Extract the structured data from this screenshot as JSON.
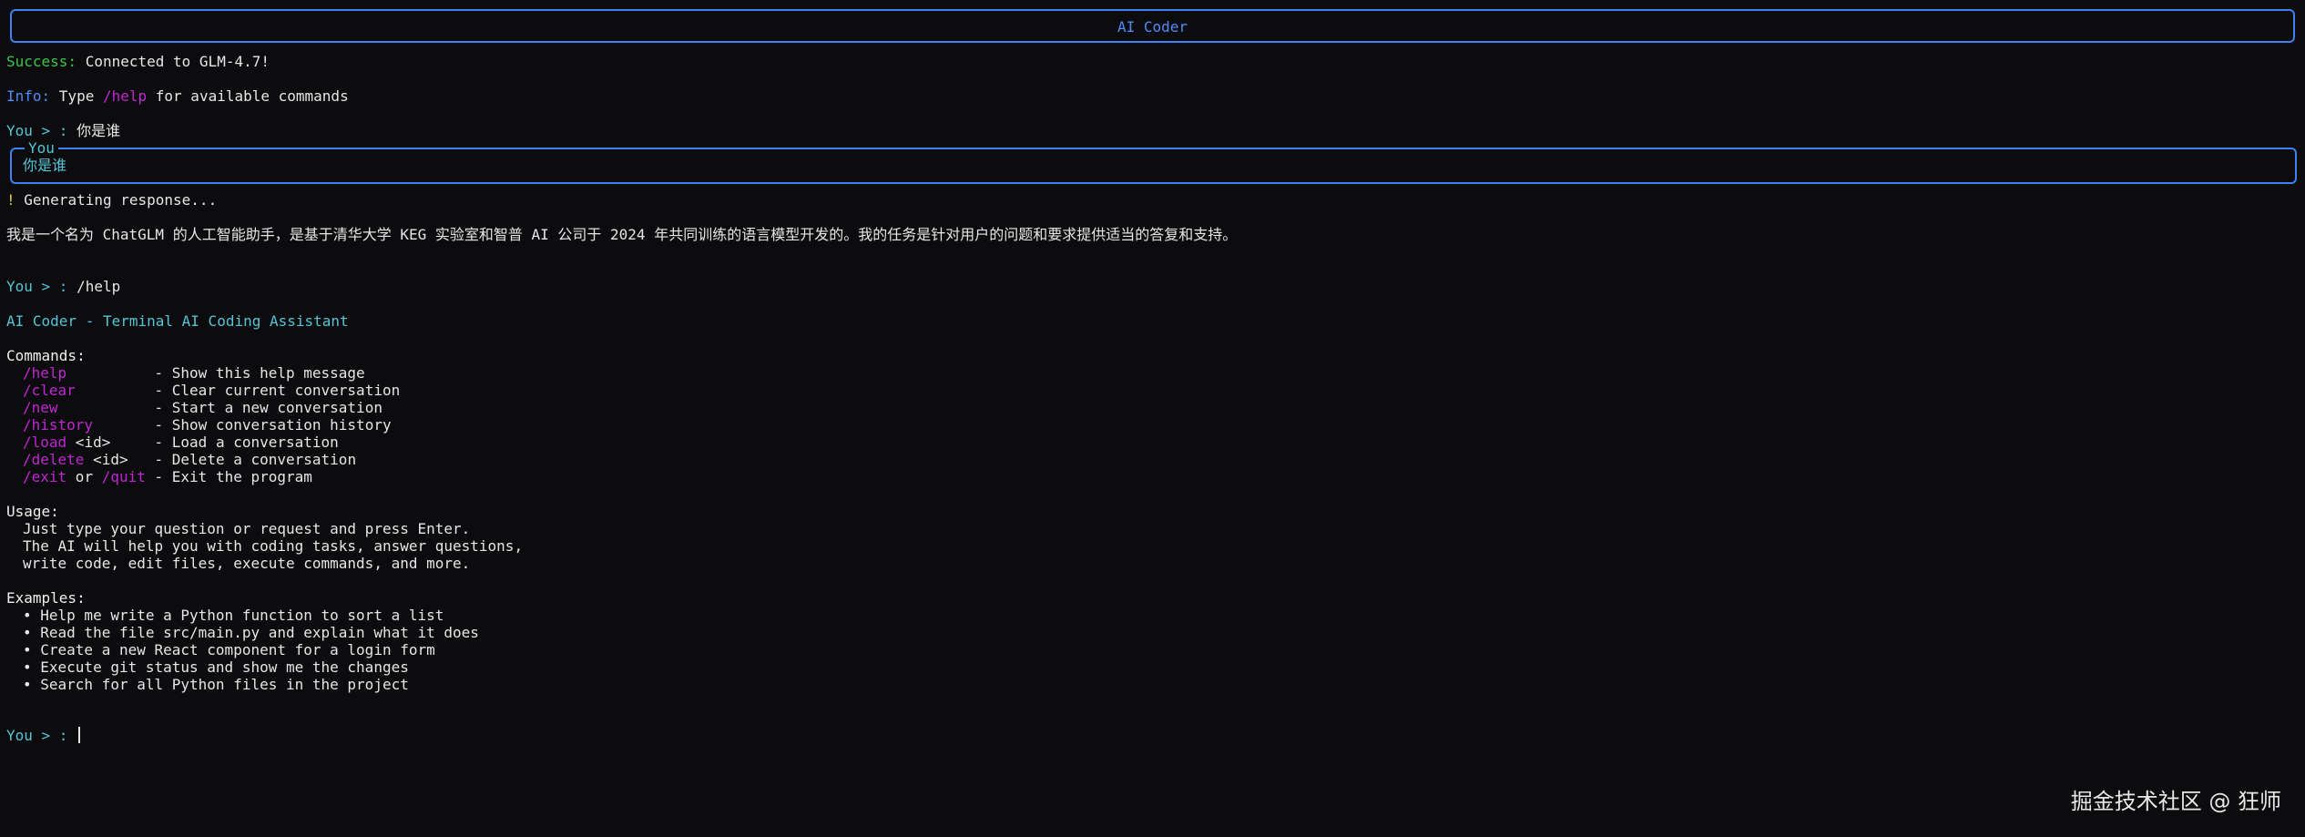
{
  "header": {
    "title": "AI Coder"
  },
  "status": {
    "success_label": "Success:",
    "success_text": " Connected to GLM-4.7!",
    "info_label": "Info:",
    "info_text_pre": " Type ",
    "info_cmd": "/help",
    "info_text_post": " for available commands"
  },
  "prompt": {
    "label": "You",
    "arrow": " > : "
  },
  "turn1": {
    "input": "你是谁",
    "box_label": "You",
    "box_text": "你是谁",
    "generating_icon": "!",
    "generating_text": " Generating response...",
    "response": "我是一个名为 ChatGLM 的人工智能助手，是基于清华大学 KEG 实验室和智普 AI 公司于 2024 年共同训练的语言模型开发的。我的任务是针对用户的问题和要求提供适当的答复和支持。"
  },
  "turn2": {
    "input": "/help"
  },
  "help": {
    "title": "AI Coder - Terminal AI Coding Assistant",
    "commands_heading": "Commands:",
    "commands": [
      {
        "cmd": "/help",
        "arg": "",
        "pad": "          ",
        "desc": "- Show this help message"
      },
      {
        "cmd": "/clear",
        "arg": "",
        "pad": "         ",
        "desc": "- Clear current conversation"
      },
      {
        "cmd": "/new",
        "arg": "",
        "pad": "           ",
        "desc": "- Start a new conversation"
      },
      {
        "cmd": "/history",
        "arg": "",
        "pad": "       ",
        "desc": "- Show conversation history"
      },
      {
        "cmd": "/load",
        "arg": " <id>",
        "pad": "     ",
        "desc": "- Load a conversation"
      },
      {
        "cmd": "/delete",
        "arg": " <id>",
        "pad": "   ",
        "desc": "- Delete a conversation"
      }
    ],
    "exit_cmd": "/exit",
    "exit_or": " or ",
    "quit_cmd": "/quit",
    "exit_desc": " - Exit the program",
    "usage_heading": "Usage:",
    "usage_lines": [
      "Just type your question or request and press Enter.",
      "The AI will help you with coding tasks, answer questions,",
      "write code, edit files, execute commands, and more."
    ],
    "examples_heading": "Examples:",
    "bullet": "• ",
    "examples": [
      "Help me write a Python function to sort a list",
      "Read the file src/main.py and explain what it does",
      "Create a new React component for a login form",
      "Execute git status and show me the changes",
      "Search for all Python files in the project"
    ]
  },
  "watermark": "掘金技术社区 @ 狂师"
}
